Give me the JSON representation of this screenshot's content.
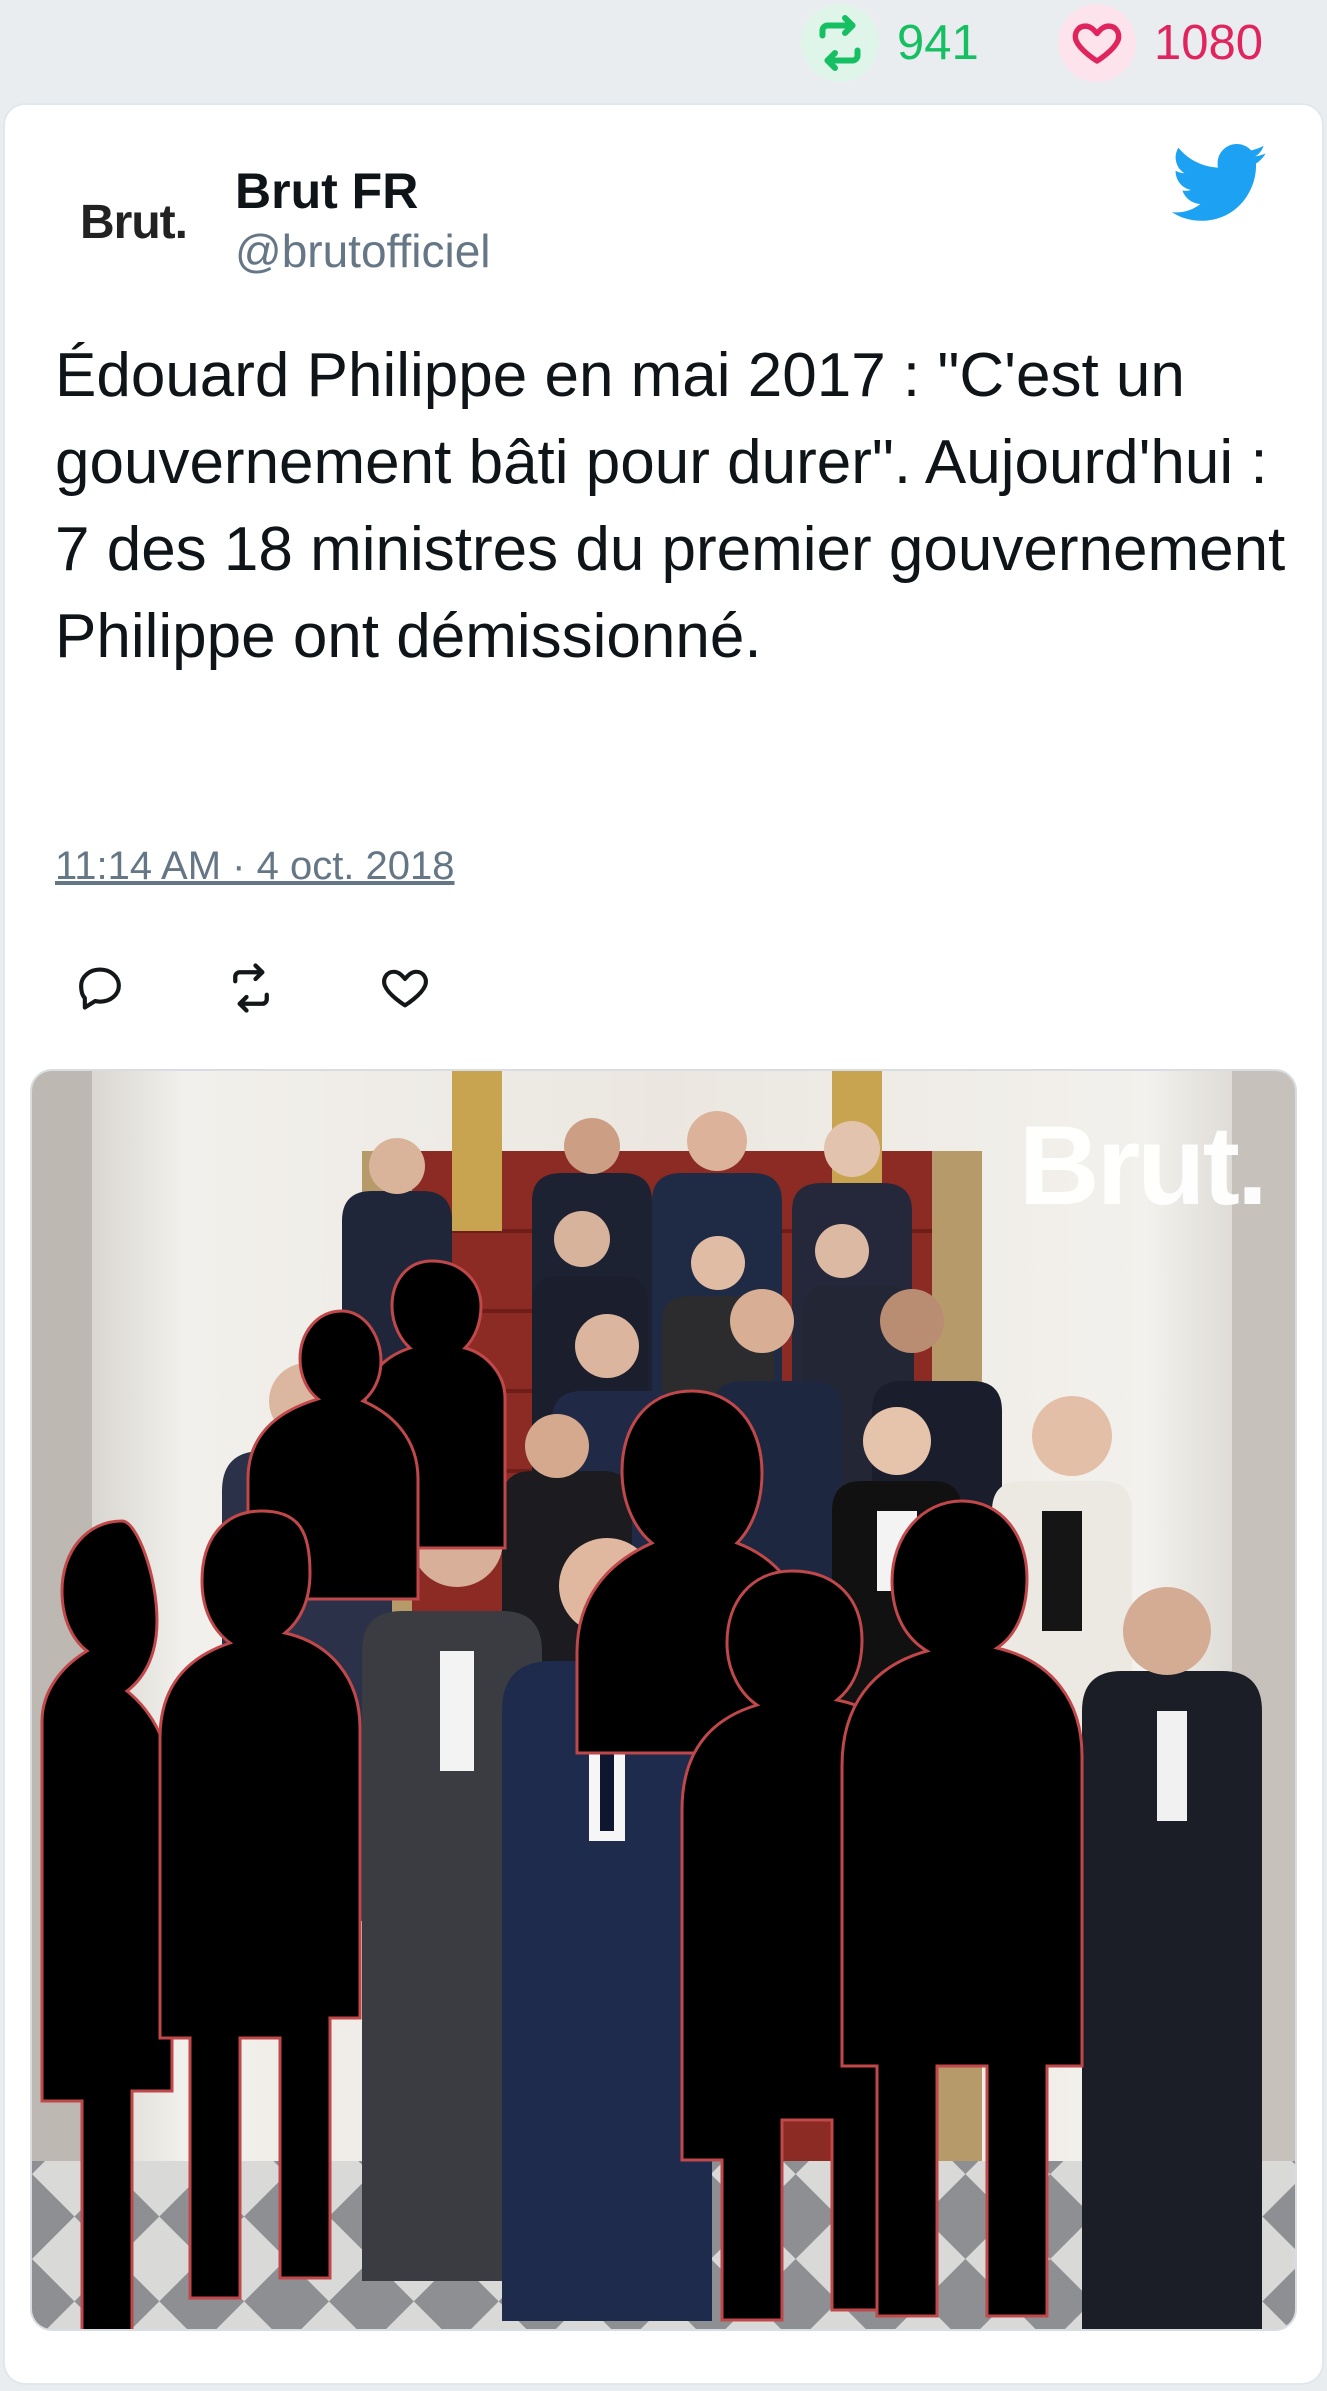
{
  "stats": {
    "retweets": "941",
    "likes": "1080"
  },
  "tweet": {
    "logo_text": "Brut.",
    "author_name": "Brut FR",
    "author_handle": "@brutofficiel",
    "text": "Édouard Philippe en mai 2017 : \"C'est un gouvernement bâti pour durer\". Aujourd'hui : 7 des 18 ministres du premier gouvernement Philippe ont démissionné.",
    "timestamp": "11:14 AM · 4 oct. 2018",
    "media_watermark": "Brut."
  },
  "icons": {
    "retweet_stat": "retweet-icon",
    "like_stat": "heart-icon",
    "twitter": "twitter-bird-icon",
    "reply": "reply-icon",
    "retweet_action": "retweet-icon",
    "like_action": "heart-icon"
  },
  "colors": {
    "retweet_green": "#17bf63",
    "like_red": "#e0245e",
    "twitter_blue": "#1da1f2",
    "muted_text": "#657786",
    "silhouette_outline": "#c0474a"
  }
}
